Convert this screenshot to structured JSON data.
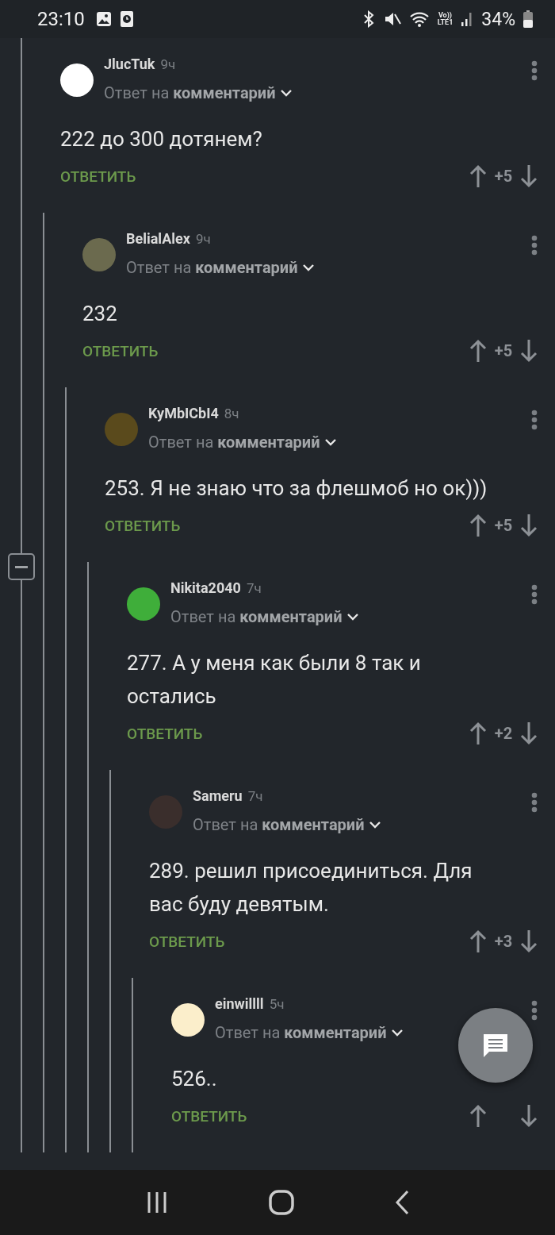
{
  "status_bar": {
    "time": "23:10",
    "volte_label": "Vo))",
    "network_label": "LTE1",
    "battery": "34%"
  },
  "comments": [
    {
      "author": "JlucTuk",
      "age": "9ч",
      "color": "#ffffff",
      "reply_to": "Ответ на **комментарий**",
      "text": "222 до 300 дотянем?",
      "reply_label": "ОТВЕТИТЬ",
      "score": "+5",
      "children": [
        {
          "author": "BelialAlex",
          "age": "9ч",
          "color": "#6b6a4e",
          "reply_to": "Ответ на **комментарий**",
          "text": "232",
          "reply_label": "ОТВЕТИТЬ",
          "score": "+5",
          "children": [
            {
              "author": "KyMbICbI4",
              "age": "8ч",
              "color": "#5a4a1c",
              "reply_to": "Ответ на **комментарий**",
              "text": "253. Я не знаю что за флешмоб но ок)))",
              "reply_label": "ОТВЕТИТЬ",
              "score": "+5",
              "children": [
                {
                  "author": "Nikita2040",
                  "age": "7ч",
                  "color": "#3fae3a",
                  "reply_to": "Ответ на **комментарий**",
                  "text": "277. А у меня как были 8 так и остались",
                  "reply_label": "ОТВЕТИТЬ",
                  "score": "+2",
                  "children": [
                    {
                      "author": "Sameru",
                      "age": "7ч",
                      "color": "#3a2e2c",
                      "reply_to": "Ответ на **комментарий**",
                      "text": "289. решил присоединиться. Для вас буду девятым.",
                      "reply_label": "ОТВЕТИТЬ",
                      "score": "+3",
                      "children": [
                        {
                          "author": "einwillll",
                          "age": "5ч",
                          "color": "#fbeecb",
                          "reply_to": "Ответ на **комментарий**",
                          "text": "526..",
                          "reply_label": "ОТВЕТИТЬ"
                        }
                      ]
                    }
                  ]
                }
              ]
            }
          ]
        }
      ]
    }
  ]
}
